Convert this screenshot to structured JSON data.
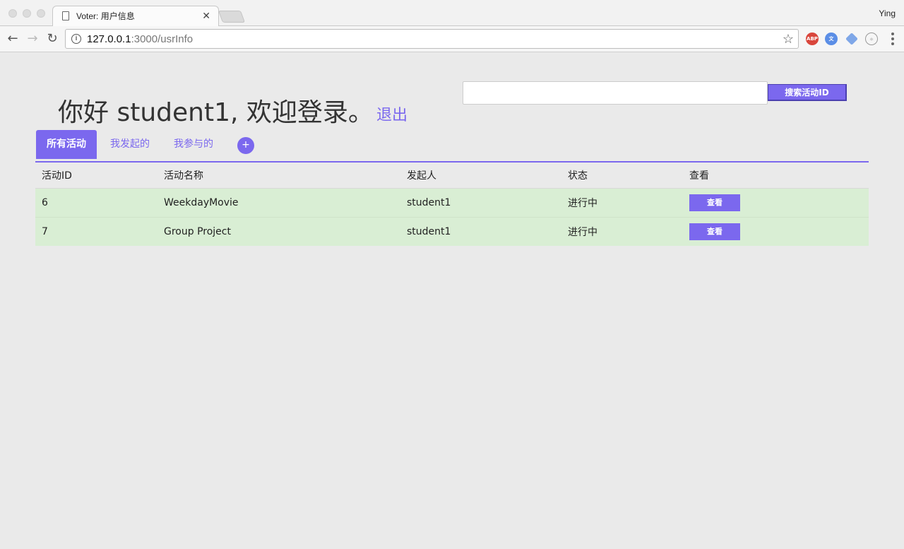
{
  "browser": {
    "tab_title": "Voter: 用户信息",
    "tab_close": "✕",
    "user": "Ying",
    "url_host": "127.0.0.1",
    "url_rest": ":3000/usrInfo"
  },
  "search": {
    "placeholder": "",
    "button_label": "搜索活动ID"
  },
  "header": {
    "greeting": "你好 student1, 欢迎登录。",
    "logout": "退出"
  },
  "tabs": [
    {
      "label": "所有活动",
      "active": true
    },
    {
      "label": "我发起的",
      "active": false
    },
    {
      "label": "我参与的",
      "active": false
    }
  ],
  "add_button": "+",
  "table": {
    "columns": [
      "活动ID",
      "活动名称",
      "发起人",
      "状态",
      "查看"
    ],
    "rows": [
      {
        "id": "6",
        "name": "WeekdayMovie",
        "owner": "student1",
        "status": "进行中",
        "action": "查看"
      },
      {
        "id": "7",
        "name": "Group Project",
        "owner": "student1",
        "status": "进行中",
        "action": "查看"
      }
    ]
  },
  "colors": {
    "accent": "#7b68ee",
    "row_bg": "#d9eed4",
    "page_bg": "#eaeaea"
  }
}
